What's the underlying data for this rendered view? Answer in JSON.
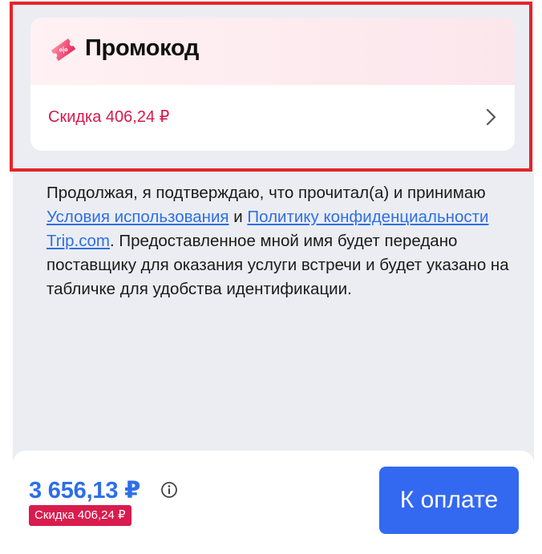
{
  "promo": {
    "title": "Промокод",
    "discount_text": "Скидка 406,24 ₽",
    "icon": "promo-ticket-icon",
    "accent_color": "#d6194a"
  },
  "terms": {
    "text_1": "Продолжая, я подтверждаю, что прочитал(а) и принимаю ",
    "link_terms": "Условия использования",
    "text_2": " и ",
    "link_privacy": "Политику конфиденциальности Trip.com",
    "text_3": ". Предоставленное мной имя будет передано поставщику для оказания услуги встречи и будет указано на табличке для удобства идентификации."
  },
  "footer": {
    "price": "3 656,13 ₽",
    "discount_badge": "Скидка 406,24 ₽",
    "pay_label": "К оплате",
    "price_color": "#2d6ee8",
    "button_color": "#3368f0"
  }
}
